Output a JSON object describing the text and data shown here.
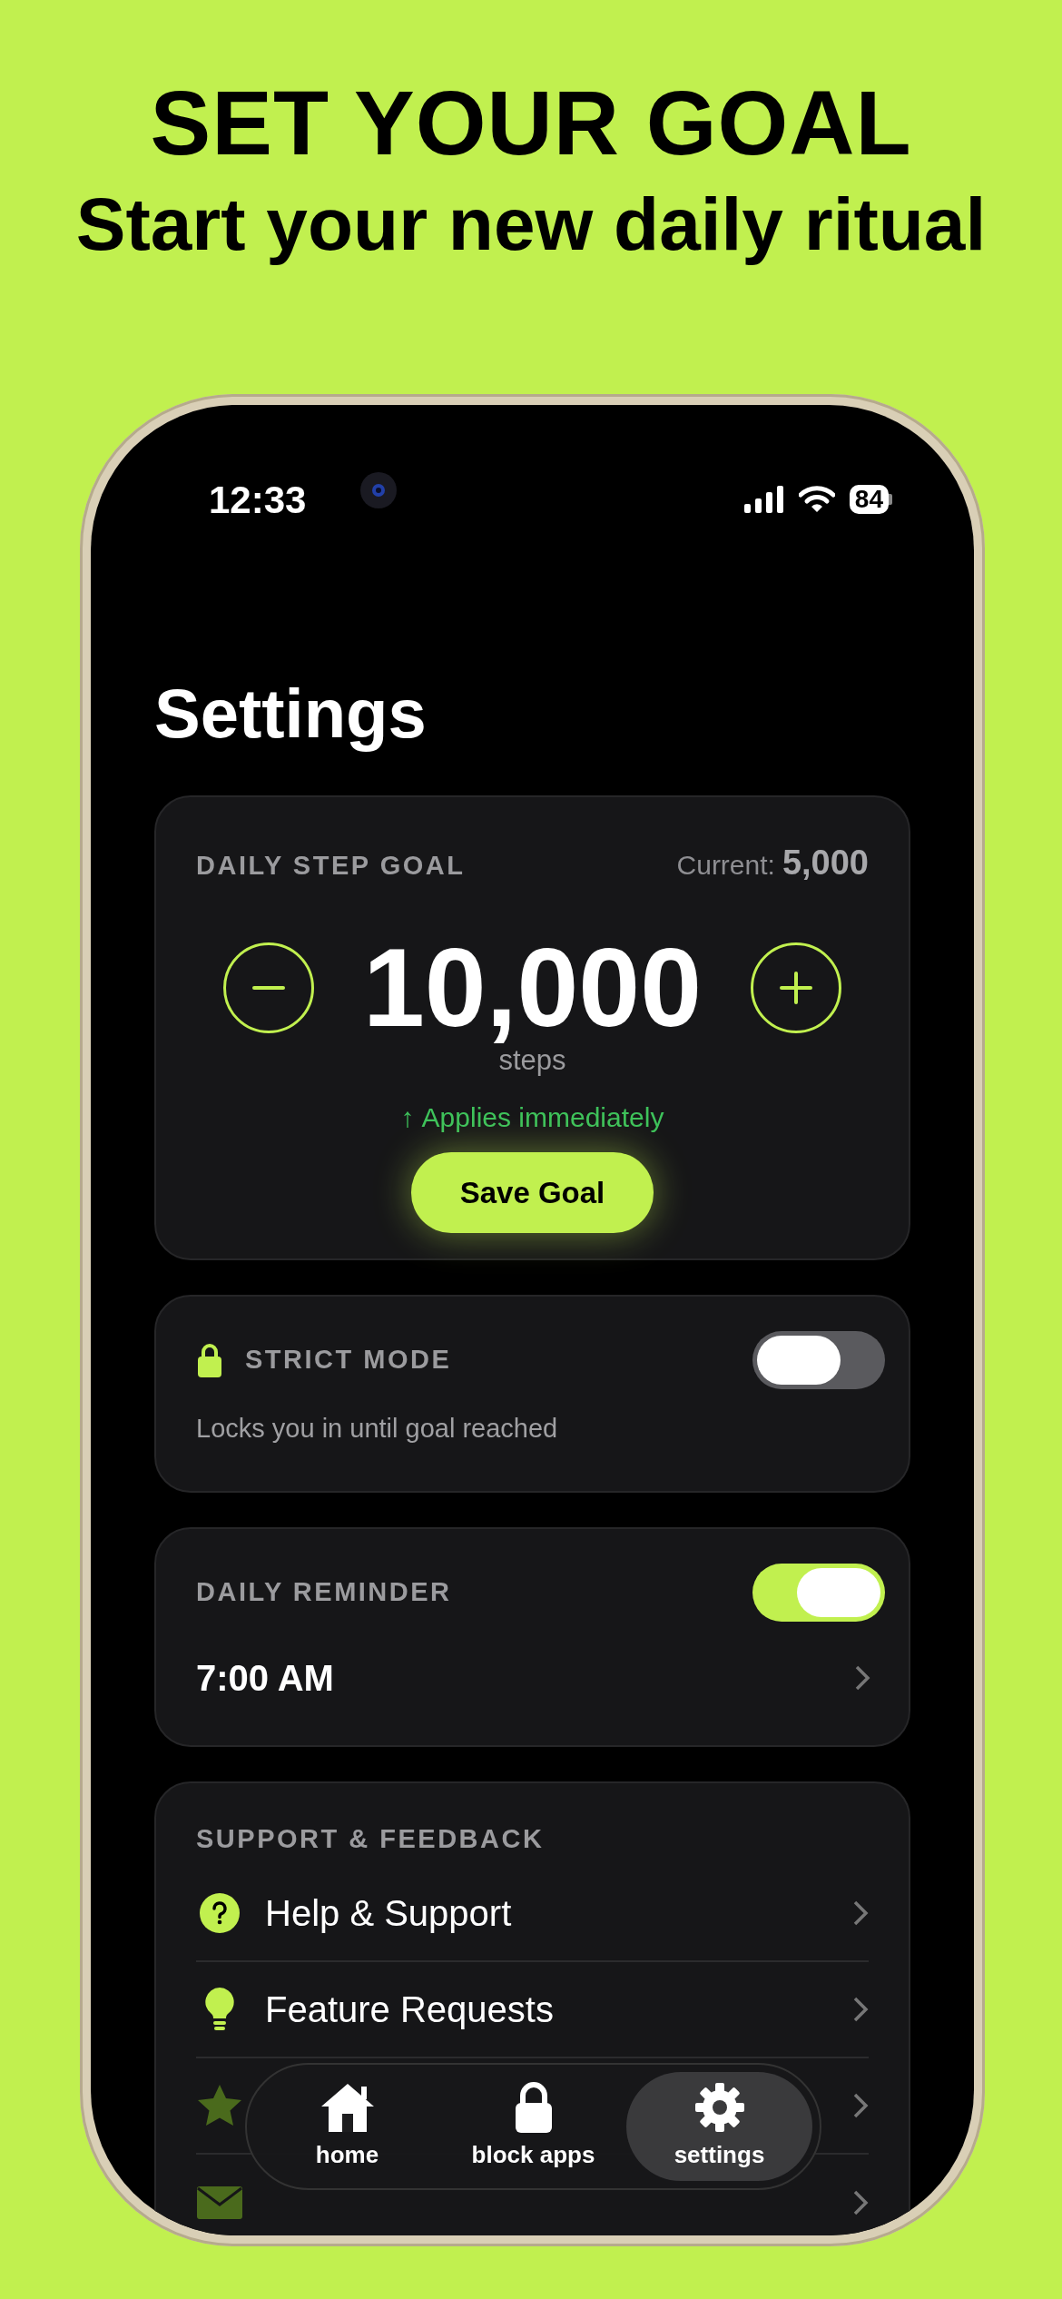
{
  "headline": "SET YOUR GOAL",
  "subheadline": "Start your new daily ritual",
  "status_bar": {
    "time": "12:33",
    "battery": "84"
  },
  "title": "Settings",
  "goal_card": {
    "label": "DAILY STEP GOAL",
    "current_label": "Current:",
    "current_value": "5,000",
    "value": "10,000",
    "unit": "steps",
    "note_icon": "↑",
    "note": "Applies immediately",
    "button": "Save Goal"
  },
  "strict_mode": {
    "label": "STRICT MODE",
    "description": "Locks you in until goal reached",
    "on": false
  },
  "reminder": {
    "label": "DAILY REMINDER",
    "on": true,
    "time": "7:00 AM"
  },
  "support": {
    "title": "SUPPORT & FEEDBACK",
    "items": [
      {
        "kind": "help",
        "label": "Help & Support"
      },
      {
        "kind": "idea",
        "label": "Feature Requests"
      },
      {
        "kind": "star"
      },
      {
        "kind": "mail"
      }
    ]
  },
  "tab_bar": [
    {
      "kind": "home",
      "label": "home",
      "selected": false
    },
    {
      "kind": "lock",
      "label": "block apps",
      "selected": false
    },
    {
      "kind": "gear",
      "label": "settings",
      "selected": true
    }
  ]
}
